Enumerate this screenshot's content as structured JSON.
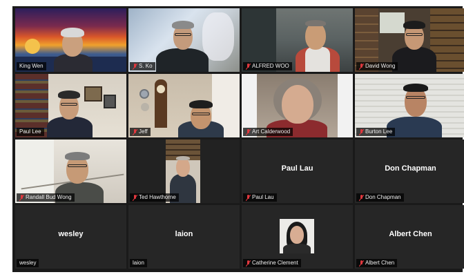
{
  "participants": [
    {
      "name": "King Wen",
      "muted": false,
      "video": true
    },
    {
      "name": "S. Ko",
      "muted": true,
      "video": true
    },
    {
      "name": "ALFRED WOO",
      "muted": true,
      "video": true
    },
    {
      "name": "David Wong",
      "muted": true,
      "video": true
    },
    {
      "name": "Paul Lee",
      "muted": false,
      "video": true
    },
    {
      "name": "Jeff",
      "muted": true,
      "video": true
    },
    {
      "name": "Art Calderwood",
      "muted": true,
      "video": true
    },
    {
      "name": "Burton Lee",
      "muted": true,
      "video": true
    },
    {
      "name": "Randall Bud Wong",
      "muted": true,
      "video": true
    },
    {
      "name": "Ted Hawthorne",
      "muted": true,
      "video": true
    },
    {
      "name": "Paul Lau",
      "muted": true,
      "video": false,
      "display_name": "Paul Lau"
    },
    {
      "name": "Don Chapman",
      "muted": true,
      "video": false,
      "display_name": "Don Chapman"
    },
    {
      "name": "wesley",
      "muted": false,
      "video": false,
      "display_name": "wesley"
    },
    {
      "name": "laion",
      "muted": false,
      "video": false,
      "display_name": "laion"
    },
    {
      "name": "Catherine Clement",
      "muted": true,
      "video": false
    },
    {
      "name": "Albert Chen",
      "muted": true,
      "video": false,
      "display_name": "Albert Chen"
    }
  ],
  "colors": {
    "active_speaker_border": "#c9d634",
    "muted_icon": "#e0383e",
    "tile_bg": "#262626"
  },
  "icons": {
    "muted": "microphone-muted-icon"
  }
}
